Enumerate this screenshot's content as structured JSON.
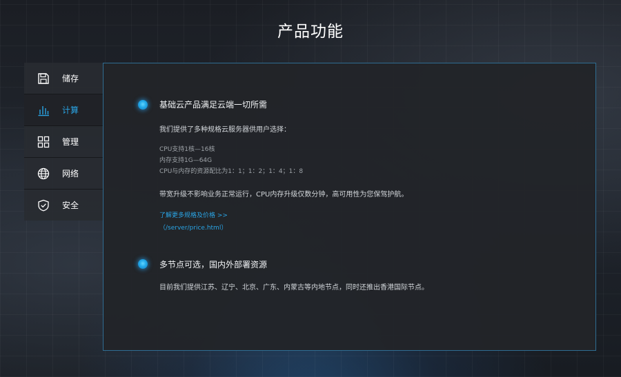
{
  "page_title": "产品功能",
  "sidebar": {
    "items": [
      {
        "label": "储存",
        "icon": "save-icon"
      },
      {
        "label": "计算",
        "icon": "bar-chart-icon"
      },
      {
        "label": "管理",
        "icon": "grid-icon"
      },
      {
        "label": "网络",
        "icon": "globe-icon"
      },
      {
        "label": "安全",
        "icon": "shield-icon"
      }
    ],
    "active": "计算"
  },
  "content": {
    "sections": [
      {
        "title": "基础云产品满足云端一切所需",
        "intro": "我们提供了多种规格云服务器供用户选择：",
        "specs": [
          "CPU支持1核—16核",
          "内存支持1G—64G",
          "CPU与内存的资源配比为1：1；1：2；1：4；1：8"
        ],
        "note": "带宽升级不影响业务正常运行，CPU内存升级仅数分钟，高可用性为您保驾护航。",
        "link_text": "了解更多规格及价格 >>",
        "link_path": "（/server/price.html）"
      },
      {
        "title": "多节点可选，国内外部署资源",
        "text": "目前我们提供江苏、辽宁、北京、广东、内蒙古等内地节点，同时还推出香港国际节点。"
      }
    ]
  },
  "colors": {
    "accent": "#2aa5e6",
    "panel_border": "#2f6d93",
    "panel_bg": "#222429",
    "sidebar_bg": "#282b31"
  }
}
